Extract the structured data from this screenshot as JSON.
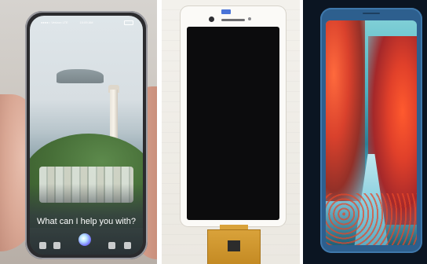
{
  "panels": [
    {
      "id": "panel-1",
      "subject": "iphone-render"
    },
    {
      "id": "panel-2",
      "subject": "display-module"
    },
    {
      "id": "panel-3",
      "subject": "phone-autumn-wallpaper"
    }
  ],
  "phone1": {
    "status_carrier": "●●●●○ Verizon LTE",
    "status_time": "10:09 AM",
    "siri_prompt": "What can I help you with?"
  },
  "colors": {
    "phone3_frame": "#2d5f8e",
    "module_flex": "#d9a23a",
    "module_tab": "#4a74d8"
  }
}
